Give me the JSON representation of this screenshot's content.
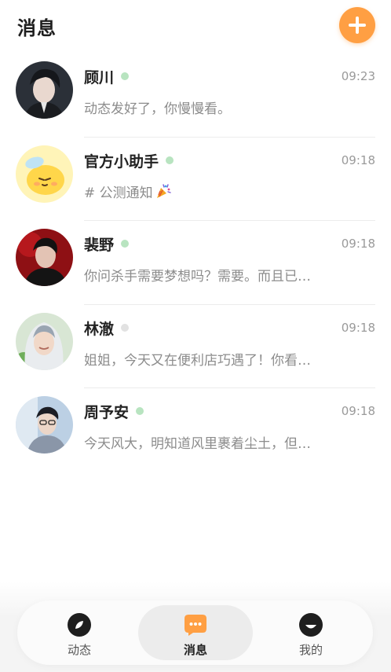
{
  "header": {
    "title": "消息",
    "add_icon": "plus-icon"
  },
  "colors": {
    "accent": "#ff9f43",
    "online_dot": "#b8e4c0",
    "offline_dot": "#e2e2e2"
  },
  "conversations": [
    {
      "name": "顾川",
      "online": true,
      "time": "09:23",
      "preview": "动态发好了，你慢慢看。",
      "has_emoji": false
    },
    {
      "name": "官方小助手",
      "online": true,
      "time": "09:18",
      "preview": "# 公测通知",
      "has_emoji": true,
      "emoji": "party-popper-icon"
    },
    {
      "name": "裴野",
      "online": true,
      "time": "09:18",
      "preview": "你问杀手需要梦想吗？需要。而且已…",
      "has_emoji": false
    },
    {
      "name": "林澈",
      "online": false,
      "time": "09:18",
      "preview": "姐姐，今天又在便利店巧遇了！你看…",
      "has_emoji": false
    },
    {
      "name": "周予安",
      "online": true,
      "time": "09:18",
      "preview": "今天风大，明知道风里裹着尘土，但…",
      "has_emoji": false
    }
  ],
  "bottom_nav": {
    "items": [
      {
        "label": "动态",
        "icon": "compass-leaf-icon",
        "active": false
      },
      {
        "label": "消息",
        "icon": "chat-bubble-icon",
        "active": true
      },
      {
        "label": "我的",
        "icon": "smile-face-icon",
        "active": false
      }
    ]
  }
}
